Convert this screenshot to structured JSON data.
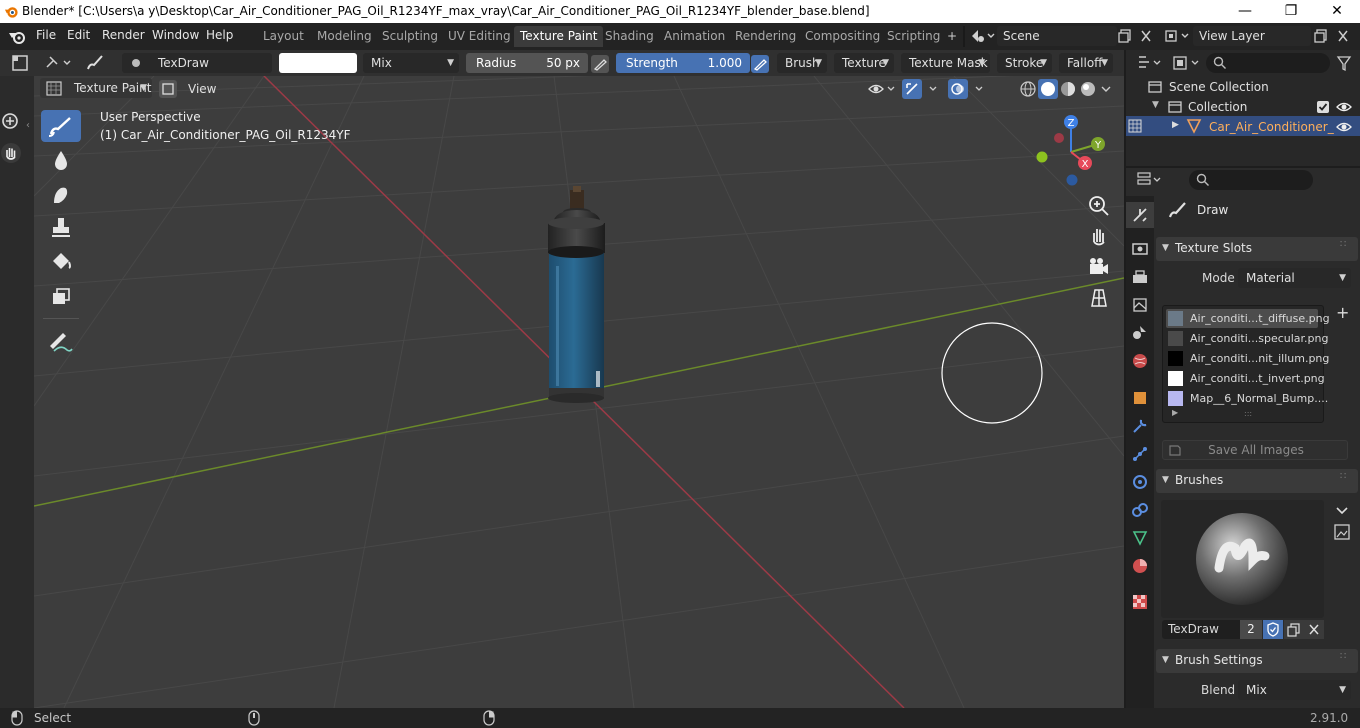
{
  "window": {
    "title": "Blender* [C:\\Users\\a y\\Desktop\\Car_Air_Conditioner_PAG_Oil_R1234YF_max_vray\\Car_Air_Conditioner_PAG_Oil_R1234YF_blender_base.blend]",
    "minimize": "—",
    "maximize": "❐",
    "close": "✕"
  },
  "menubar": {
    "items": [
      "File",
      "Edit",
      "Render",
      "Window",
      "Help"
    ],
    "workspaces": [
      "Layout",
      "Modeling",
      "Sculpting",
      "UV Editing",
      "Texture Paint",
      "Shading",
      "Animation",
      "Rendering",
      "Compositing",
      "Scripting"
    ],
    "active_workspace": "Texture Paint",
    "add_tab": "+",
    "scene": "Scene",
    "view_layer": "View Layer"
  },
  "toolheader": {
    "brush_name": "TexDraw",
    "blend_mode": "Mix",
    "radius_label": "Radius",
    "radius_value": "50 px",
    "strength_label": "Strength",
    "strength_value": "1.000",
    "strength_fraction": 1.0,
    "menus": [
      "Brush",
      "Texture",
      "Texture Mask",
      "Stroke",
      "Falloff"
    ]
  },
  "viewport_header": {
    "mode": "Texture Paint",
    "view_menu": "View"
  },
  "viewport": {
    "perspective": "User Perspective",
    "object_label": "(1) Car_Air_Conditioner_PAG_Oil_R1234YF",
    "gizmo": {
      "x": "X",
      "y": "Y",
      "z": "Z"
    },
    "colors": {
      "x_axis": "#e64a5a",
      "y_axis": "#7ea52b",
      "z_axis": "#3f80e6",
      "background": "#3d3d3d"
    }
  },
  "tools": [
    "draw-brush",
    "soften-brush",
    "smear-brush",
    "clone-brush",
    "fill-brush",
    "mask-brush",
    "annotate"
  ],
  "outliner": {
    "scene_collection": "Scene Collection",
    "collection": "Collection",
    "object": "Car_Air_Conditioner_"
  },
  "properties": {
    "tool_name": "Draw",
    "texture_slots": {
      "title": "Texture Slots",
      "mode_label": "Mode",
      "mode_value": "Material",
      "slots": [
        {
          "name": "Air_conditi...t_diffuse.png",
          "color": "#6b7a88"
        },
        {
          "name": "Air_conditi...specular.png",
          "color": "#4a4a4a"
        },
        {
          "name": "Air_conditi...nit_illum.png",
          "color": "#000000"
        },
        {
          "name": "Air_conditi...t_invert.png",
          "color": "#ffffff"
        },
        {
          "name": "Map__6_Normal_Bump....",
          "color": "#b8b8f0"
        }
      ],
      "save_all": "Save All Images",
      "add": "+"
    },
    "brushes": {
      "title": "Brushes",
      "brush_name": "TexDraw",
      "users": "2"
    },
    "brush_settings": {
      "title": "Brush Settings",
      "blend_label": "Blend",
      "blend_value": "Mix"
    }
  },
  "statusbar": {
    "select": "Select",
    "version": "2.91.0"
  }
}
